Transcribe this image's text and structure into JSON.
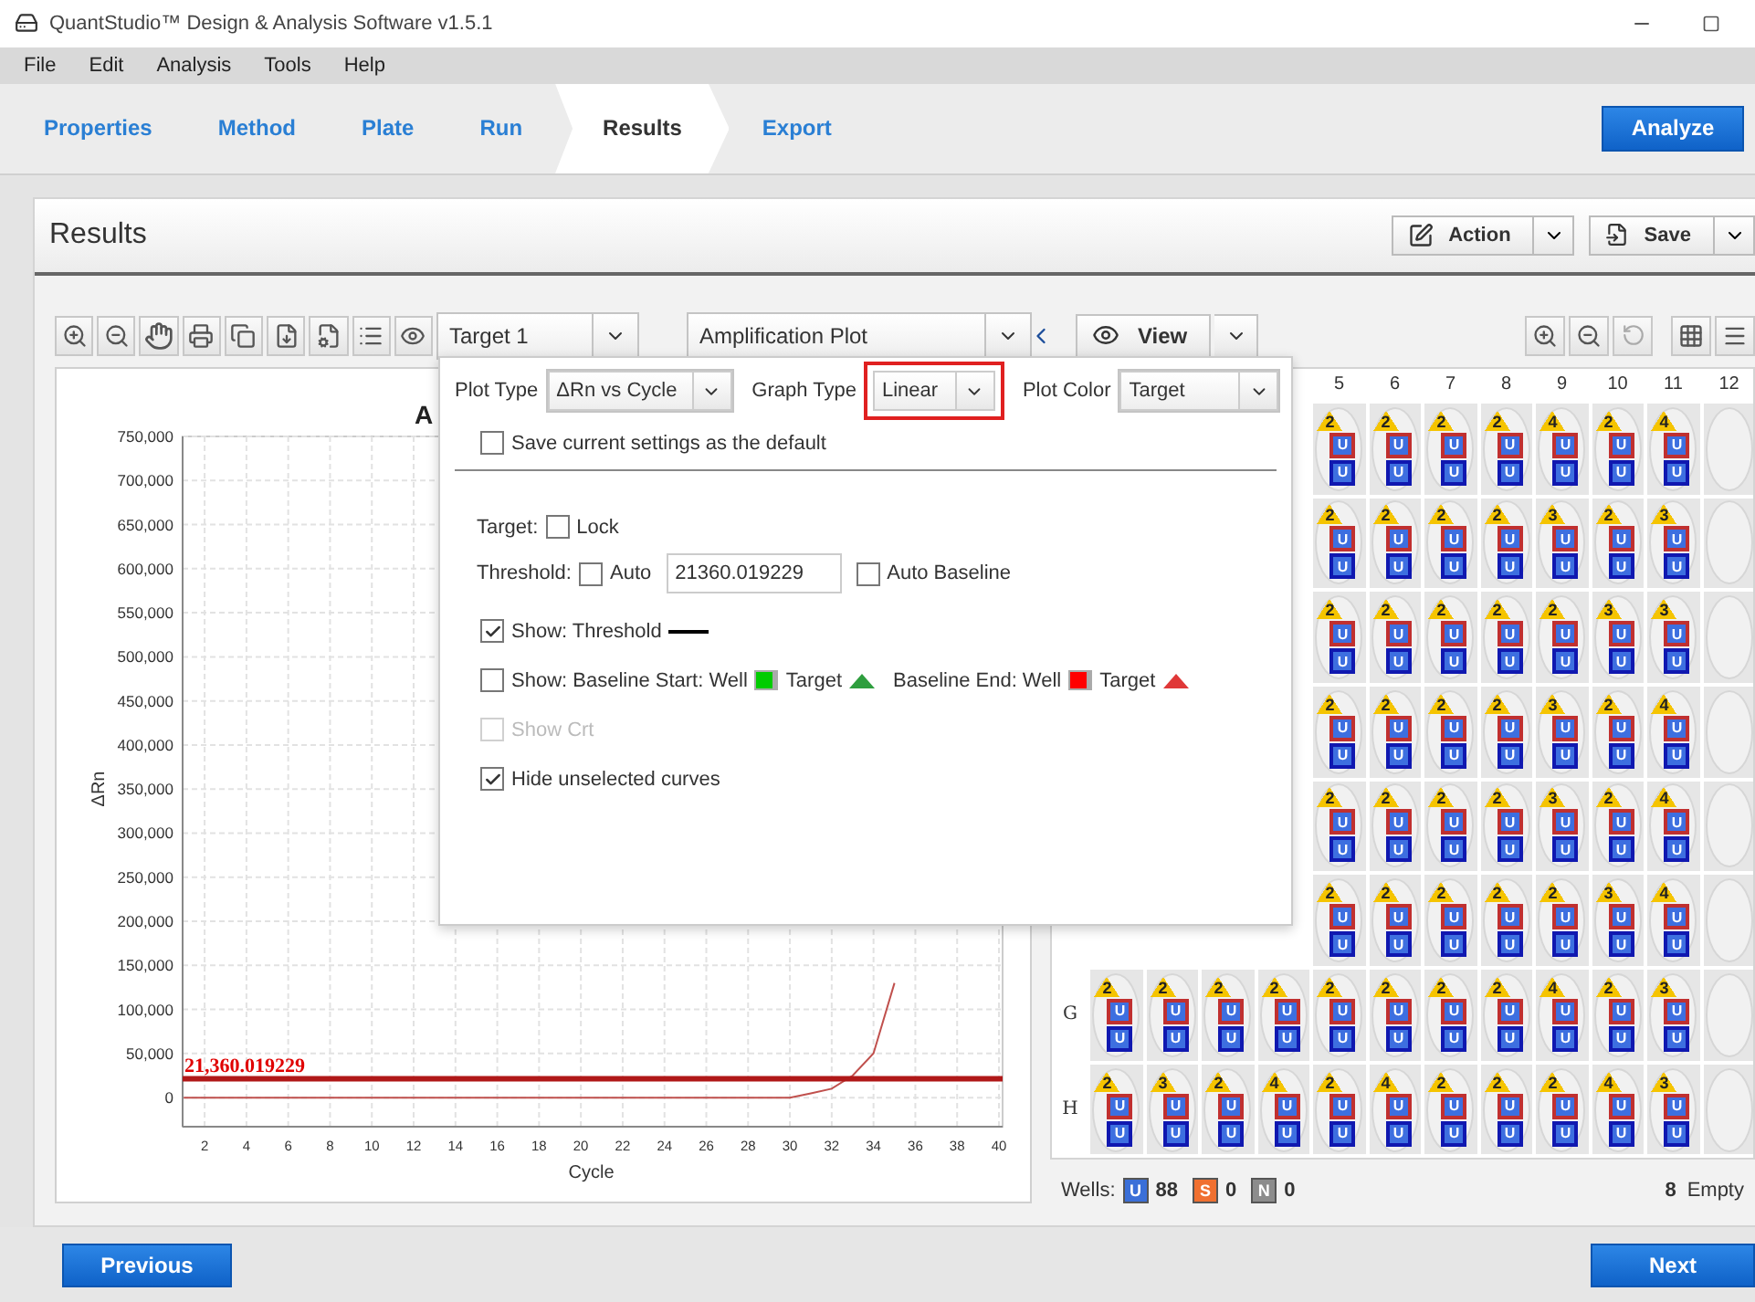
{
  "window": {
    "title": "QuantStudio™ Design & Analysis Software v1.5.1"
  },
  "menu": [
    "File",
    "Edit",
    "Analysis",
    "Tools",
    "Help"
  ],
  "nav_tabs": [
    {
      "label": "Properties",
      "selected": false
    },
    {
      "label": "Method",
      "selected": false
    },
    {
      "label": "Plate",
      "selected": false
    },
    {
      "label": "Run",
      "selected": false
    },
    {
      "label": "Results",
      "selected": true
    },
    {
      "label": "Export",
      "selected": false
    }
  ],
  "analyze_button": "Analyze",
  "results": {
    "title": "Results",
    "action_button": "Action",
    "save_button": "Save",
    "target_select": "Target 1",
    "plot_select": "Amplification Plot",
    "view_button": "View",
    "chart_data": {
      "type": "line",
      "title": "A",
      "xlabel": "Cycle",
      "ylabel": "ΔRn",
      "xlim": [
        1,
        40
      ],
      "ylim": [
        -33000,
        750000
      ],
      "x": [
        1,
        2,
        3,
        4,
        5,
        6,
        7,
        8,
        9,
        10,
        11,
        12,
        13,
        14,
        15,
        16,
        17,
        18,
        19,
        20,
        21,
        22,
        23,
        24,
        25,
        26,
        27,
        28,
        29,
        30,
        31,
        32,
        33,
        34,
        35
      ],
      "grid": true,
      "series": [
        {
          "color": "#c0504d",
          "values": [
            0,
            0,
            0,
            0,
            0,
            0,
            0,
            0,
            0,
            0,
            0,
            0,
            0,
            0,
            0,
            0,
            0,
            0,
            0,
            0,
            0,
            0,
            0,
            0,
            0,
            0,
            0,
            0,
            0,
            0,
            5000,
            10000,
            25000,
            50000,
            130000
          ]
        }
      ],
      "xticks": [
        2,
        4,
        6,
        8,
        10,
        12,
        14,
        16,
        18,
        20,
        22,
        24,
        26,
        28,
        30,
        32,
        34,
        36,
        38,
        40
      ],
      "yticks": [
        {
          "value": 0,
          "label": "0"
        },
        {
          "value": 50000,
          "label": "50,000"
        },
        {
          "value": 100000,
          "label": "100,000"
        },
        {
          "value": 150000,
          "label": "150,000"
        },
        {
          "value": 200000,
          "label": "200,000"
        },
        {
          "value": 250000,
          "label": "250,000"
        },
        {
          "value": 300000,
          "label": "300,000"
        },
        {
          "value": 350000,
          "label": "350,000"
        },
        {
          "value": 400000,
          "label": "400,000"
        },
        {
          "value": 450000,
          "label": "450,000"
        },
        {
          "value": 500000,
          "label": "500,000"
        },
        {
          "value": 550000,
          "label": "550,000"
        },
        {
          "value": 600000,
          "label": "600,000"
        },
        {
          "value": 650000,
          "label": "650,000"
        },
        {
          "value": 700000,
          "label": "700,000"
        },
        {
          "value": 750000,
          "label": "750,000"
        }
      ],
      "ref_lines": [
        {
          "axis": "y",
          "value": 21360.019229,
          "label": "21,360.019229"
        }
      ]
    },
    "plate": {
      "column_labels": [
        "5",
        "6",
        "7",
        "8",
        "9",
        "10",
        "11",
        "12"
      ],
      "rows": [
        {
          "wells": [
            {
              "kind": "sample",
              "count": "2",
              "tasks": [
                "U",
                "U"
              ]
            },
            {
              "kind": "sample",
              "count": "2",
              "tasks": [
                "U",
                "U"
              ]
            },
            {
              "kind": "sample",
              "count": "2",
              "tasks": [
                "U",
                "U"
              ]
            },
            {
              "kind": "sample",
              "count": "2",
              "tasks": [
                "U",
                "U"
              ]
            },
            {
              "kind": "sample",
              "count": "4",
              "tasks": [
                "U",
                "U"
              ]
            },
            {
              "kind": "sample",
              "count": "2",
              "tasks": [
                "U",
                "U"
              ]
            },
            {
              "kind": "sample",
              "count": "4",
              "tasks": [
                "U",
                "U"
              ]
            },
            {
              "kind": "empty"
            }
          ]
        },
        {
          "wells": [
            {
              "kind": "sample",
              "count": "2",
              "tasks": [
                "U",
                "U"
              ]
            },
            {
              "kind": "sample",
              "count": "2",
              "tasks": [
                "U",
                "U"
              ]
            },
            {
              "kind": "sample",
              "count": "2",
              "tasks": [
                "U",
                "U"
              ]
            },
            {
              "kind": "sample",
              "count": "2",
              "tasks": [
                "U",
                "U"
              ]
            },
            {
              "kind": "sample",
              "count": "3",
              "tasks": [
                "U",
                "U"
              ]
            },
            {
              "kind": "sample",
              "count": "2",
              "tasks": [
                "U",
                "U"
              ]
            },
            {
              "kind": "sample",
              "count": "3",
              "tasks": [
                "U",
                "U"
              ]
            },
            {
              "kind": "empty"
            }
          ]
        },
        {
          "wells": [
            {
              "kind": "sample",
              "count": "2",
              "tasks": [
                "U",
                "U"
              ]
            },
            {
              "kind": "sample",
              "count": "2",
              "tasks": [
                "U",
                "U"
              ]
            },
            {
              "kind": "sample",
              "count": "2",
              "tasks": [
                "U",
                "U"
              ]
            },
            {
              "kind": "sample",
              "count": "2",
              "tasks": [
                "U",
                "U"
              ]
            },
            {
              "kind": "sample",
              "count": "2",
              "tasks": [
                "U",
                "U"
              ]
            },
            {
              "kind": "sample",
              "count": "3",
              "tasks": [
                "U",
                "U"
              ]
            },
            {
              "kind": "sample",
              "count": "3",
              "tasks": [
                "U",
                "U"
              ]
            },
            {
              "kind": "empty"
            }
          ]
        },
        {
          "wells": [
            {
              "kind": "sample",
              "count": "2",
              "tasks": [
                "U",
                "U"
              ]
            },
            {
              "kind": "sample",
              "count": "2",
              "tasks": [
                "U",
                "U"
              ]
            },
            {
              "kind": "sample",
              "count": "2",
              "tasks": [
                "U",
                "U"
              ]
            },
            {
              "kind": "sample",
              "count": "2",
              "tasks": [
                "U",
                "U"
              ]
            },
            {
              "kind": "sample",
              "count": "3",
              "tasks": [
                "U",
                "U"
              ]
            },
            {
              "kind": "sample",
              "count": "2",
              "tasks": [
                "U",
                "U"
              ]
            },
            {
              "kind": "sample",
              "count": "4",
              "tasks": [
                "U",
                "U"
              ]
            },
            {
              "kind": "empty"
            }
          ]
        },
        {
          "wells": [
            {
              "kind": "sample",
              "count": "2",
              "tasks": [
                "U",
                "U"
              ]
            },
            {
              "kind": "sample",
              "count": "2",
              "tasks": [
                "U",
                "U"
              ]
            },
            {
              "kind": "sample",
              "count": "2",
              "tasks": [
                "U",
                "U"
              ]
            },
            {
              "kind": "sample",
              "count": "2",
              "tasks": [
                "U",
                "U"
              ]
            },
            {
              "kind": "sample",
              "count": "3",
              "tasks": [
                "U",
                "U"
              ]
            },
            {
              "kind": "sample",
              "count": "2",
              "tasks": [
                "U",
                "U"
              ]
            },
            {
              "kind": "sample",
              "count": "4",
              "tasks": [
                "U",
                "U"
              ]
            },
            {
              "kind": "empty"
            }
          ]
        },
        {
          "wells": [
            {
              "kind": "sample",
              "count": "2",
              "tasks": [
                "U",
                "U"
              ]
            },
            {
              "kind": "sample",
              "count": "2",
              "tasks": [
                "U",
                "U"
              ]
            },
            {
              "kind": "sample",
              "count": "2",
              "tasks": [
                "U",
                "U"
              ]
            },
            {
              "kind": "sample",
              "count": "2",
              "tasks": [
                "U",
                "U"
              ]
            },
            {
              "kind": "sample",
              "count": "2",
              "tasks": [
                "U",
                "U"
              ]
            },
            {
              "kind": "sample",
              "count": "3",
              "tasks": [
                "U",
                "U"
              ]
            },
            {
              "kind": "sample",
              "count": "4",
              "tasks": [
                "U",
                "U"
              ]
            },
            {
              "kind": "empty"
            }
          ]
        },
        {
          "label": "G",
          "wells": [
            {
              "kind": "sample",
              "count": "2",
              "tasks": [
                "U",
                "U"
              ]
            },
            {
              "kind": "sample",
              "count": "2",
              "tasks": [
                "U",
                "U"
              ]
            },
            {
              "kind": "sample",
              "count": "2",
              "tasks": [
                "U",
                "U"
              ]
            },
            {
              "kind": "sample",
              "count": "2",
              "tasks": [
                "U",
                "U"
              ]
            },
            {
              "kind": "sample",
              "count": "2",
              "tasks": [
                "U",
                "U"
              ]
            },
            {
              "kind": "sample",
              "count": "2",
              "tasks": [
                "U",
                "U"
              ]
            },
            {
              "kind": "sample",
              "count": "2",
              "tasks": [
                "U",
                "U"
              ]
            },
            {
              "kind": "sample",
              "count": "2",
              "tasks": [
                "U",
                "U"
              ]
            },
            {
              "kind": "sample",
              "count": "4",
              "tasks": [
                "U",
                "U"
              ]
            },
            {
              "kind": "sample",
              "count": "2",
              "tasks": [
                "U",
                "U"
              ]
            },
            {
              "kind": "sample",
              "count": "3",
              "tasks": [
                "U",
                "U"
              ]
            },
            {
              "kind": "empty"
            }
          ]
        },
        {
          "label": "H",
          "wells": [
            {
              "kind": "sample",
              "count": "2",
              "tasks": [
                "U",
                "U"
              ]
            },
            {
              "kind": "sample",
              "count": "3",
              "tasks": [
                "U",
                "U"
              ]
            },
            {
              "kind": "sample",
              "count": "2",
              "tasks": [
                "U",
                "U"
              ]
            },
            {
              "kind": "sample",
              "count": "4",
              "tasks": [
                "U",
                "U"
              ]
            },
            {
              "kind": "sample",
              "count": "2",
              "tasks": [
                "U",
                "U"
              ]
            },
            {
              "kind": "sample",
              "count": "4",
              "tasks": [
                "U",
                "U"
              ]
            },
            {
              "kind": "sample",
              "count": "2",
              "tasks": [
                "U",
                "U"
              ]
            },
            {
              "kind": "sample",
              "count": "2",
              "tasks": [
                "U",
                "U"
              ]
            },
            {
              "kind": "sample",
              "count": "2",
              "tasks": [
                "U",
                "U"
              ]
            },
            {
              "kind": "sample",
              "count": "4",
              "tasks": [
                "U",
                "U"
              ]
            },
            {
              "kind": "sample",
              "count": "3",
              "tasks": [
                "U",
                "U"
              ]
            },
            {
              "kind": "empty"
            }
          ]
        }
      ]
    },
    "legend": {
      "label": "Wells:",
      "items": [
        {
          "letter": "U",
          "count": "88",
          "color": "#3a6fd8"
        },
        {
          "letter": "S",
          "count": "0",
          "color": "#f07030"
        },
        {
          "letter": "N",
          "count": "0",
          "color": "#8c8c8c"
        }
      ],
      "empty_count": "8",
      "empty_label": "Empty"
    }
  },
  "popup": {
    "selects": [
      {
        "label": "Plot Type",
        "value": "ΔRn vs Cycle",
        "highlighted": false
      },
      {
        "label": "Graph Type",
        "value": "Linear",
        "highlighted": true
      },
      {
        "label": "Plot Color",
        "value": "Target",
        "highlighted": false
      }
    ],
    "save_default": {
      "label": "Save current settings as the default",
      "checked": false
    },
    "target": {
      "label": "Target:",
      "lock": {
        "label": "Lock",
        "checked": false
      }
    },
    "threshold": {
      "label": "Threshold:",
      "auto": {
        "label": "Auto",
        "checked": false
      },
      "value": "21360.019229",
      "auto_baseline": {
        "label": "Auto Baseline",
        "checked": false
      }
    },
    "options": [
      {
        "kind": "threshold",
        "label": "Show: Threshold",
        "checked": true,
        "disabled": false
      },
      {
        "kind": "baseline",
        "checked": false,
        "disabled": false,
        "parts": [
          {
            "text": "Show: Baseline Start: Well",
            "kind": "square",
            "color": "#00cc00"
          },
          {
            "text": "Target",
            "kind": "triangle",
            "color": "#2e9e3e"
          },
          {
            "text": "Baseline End: Well",
            "kind": "square",
            "color": "#ff0000"
          },
          {
            "text": "Target",
            "kind": "triangle",
            "color": "#e03838"
          }
        ]
      },
      {
        "kind": "plain",
        "label": "Show Crt",
        "checked": false,
        "disabled": true
      },
      {
        "kind": "plain",
        "label": "Hide unselected curves",
        "checked": true,
        "disabled": false
      }
    ]
  },
  "footer": {
    "previous": "Previous",
    "next": "Next"
  }
}
